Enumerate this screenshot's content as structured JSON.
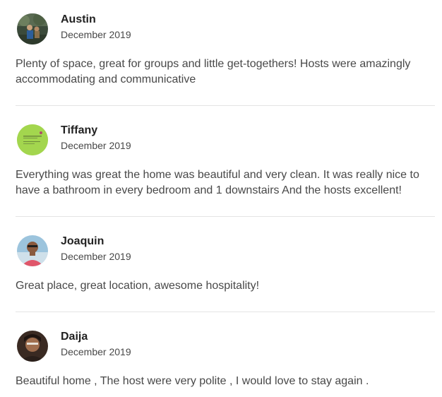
{
  "reviews": [
    {
      "name": "Austin",
      "date": "December 2019",
      "text": "Plenty of space, great for groups and little get-togethers! Hosts were amazingly accommodating and communicative"
    },
    {
      "name": "Tiffany",
      "date": "December 2019",
      "text": "Everything was great the home was beautiful and very clean. It was really nice to have a bathroom in every bedroom and 1 downstairs And the hosts excellent!"
    },
    {
      "name": "Joaquin",
      "date": "December 2019",
      "text": "Great place, great location, awesome hospitality!"
    },
    {
      "name": "Daija",
      "date": "December 2019",
      "text": "Beautiful home , The host were very polite , I would love to stay again ."
    }
  ],
  "colors": {
    "text_primary": "#222222",
    "text_secondary": "#484848",
    "divider": "#e4e4e4",
    "background": "#ffffff"
  }
}
